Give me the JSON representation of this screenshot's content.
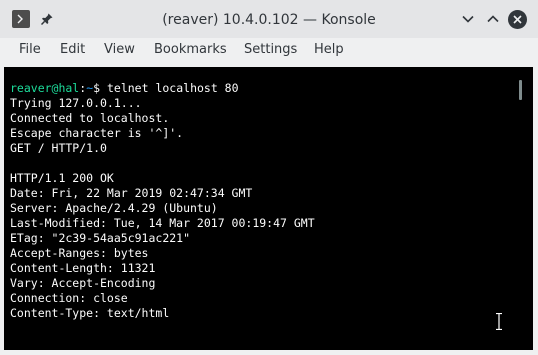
{
  "window": {
    "title": "(reaver) 10.4.0.102 — Konsole"
  },
  "menubar": {
    "items": [
      "File",
      "Edit",
      "View",
      "Bookmarks",
      "Settings",
      "Help"
    ]
  },
  "terminal": {
    "prompt_user": "reaver@hal",
    "prompt_sep": ":",
    "prompt_path": "~",
    "prompt_dollar": "$ ",
    "command": "telnet localhost 80",
    "output": [
      "Trying 127.0.0.1...",
      "Connected to localhost.",
      "Escape character is '^]'.",
      "GET / HTTP/1.0",
      "",
      "HTTP/1.1 200 OK",
      "Date: Fri, 22 Mar 2019 02:47:34 GMT",
      "Server: Apache/2.4.29 (Ubuntu)",
      "Last-Modified: Tue, 14 Mar 2017 00:19:47 GMT",
      "ETag: \"2c39-54aa5c91ac221\"",
      "Accept-Ranges: bytes",
      "Content-Length: 11321",
      "Vary: Accept-Encoding",
      "Connection: close",
      "Content-Type: text/html"
    ]
  },
  "colors": {
    "terminal_bg": "#000000",
    "terminal_fg": "#fcfcfc",
    "prompt_user": "#1cdc9a",
    "prompt_path": "#1d99f3",
    "titlebar_bg": "#e4e5e7",
    "window_bg": "#eff0f1"
  },
  "icons": {
    "titlebar_menu": "terminal-menu-icon",
    "pin": "pin-icon",
    "minimize": "chevron-down-icon",
    "maximize": "chevron-up-icon",
    "close": "close-icon",
    "cursor": "ibeam-cursor-icon"
  }
}
